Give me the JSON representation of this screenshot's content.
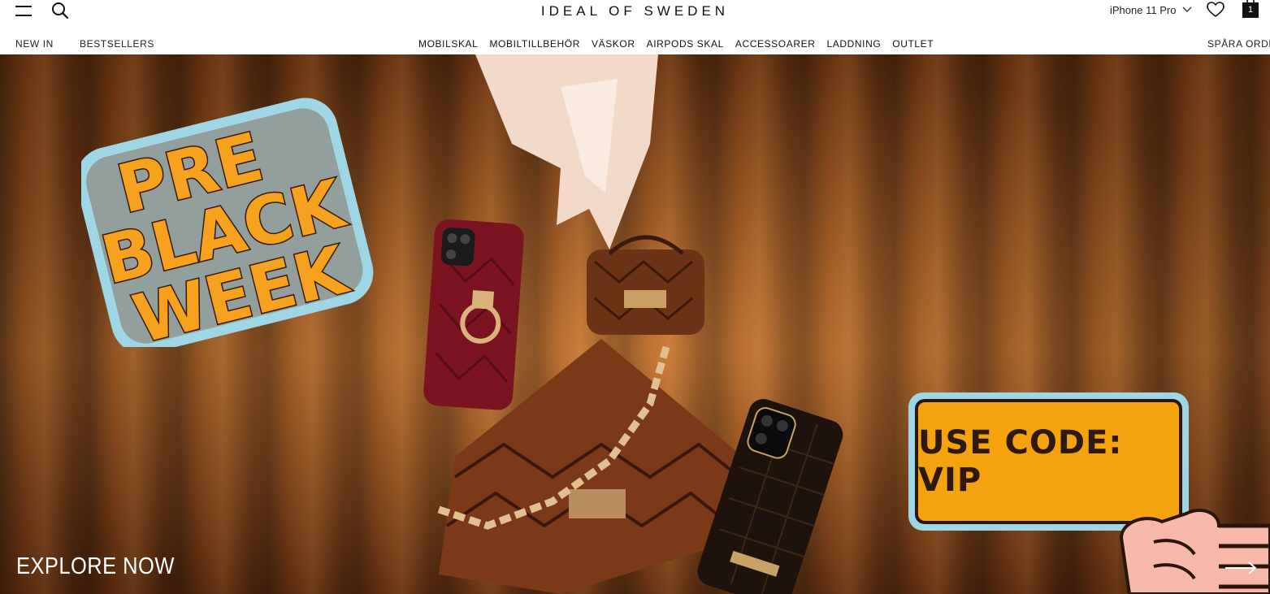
{
  "header": {
    "logo": "IDEAL OF SWEDEN",
    "device_selector": "iPhone 11 Pro",
    "cart_count": "1",
    "icons": [
      "hamburger-menu-icon",
      "search-icon",
      "chevron-down-icon",
      "heart-icon",
      "shopping-bag-icon"
    ]
  },
  "nav": {
    "left": [
      "NEW IN",
      "BESTSELLERS"
    ],
    "center": [
      "MOBILSKAL",
      "MOBILTILLBEHÖR",
      "VÄSKOR",
      "AIRPODS SKAL",
      "ACCESSOARER",
      "LADDNING",
      "OUTLET"
    ],
    "right": "SPÅRA ORDER"
  },
  "hero": {
    "sticker_lines": [
      "PRE",
      "BLACK",
      "WEEK"
    ],
    "promo_code": "USE CODE: VIP",
    "cta": "EXPLORE NOW",
    "next_icon": "arrow-right-icon"
  },
  "colors": {
    "sticker_orange": "#f6a21e",
    "promo_orange": "#f5a20f",
    "sticker_outline": "#9fd6e6",
    "curtain_brown": "#8a4516"
  }
}
